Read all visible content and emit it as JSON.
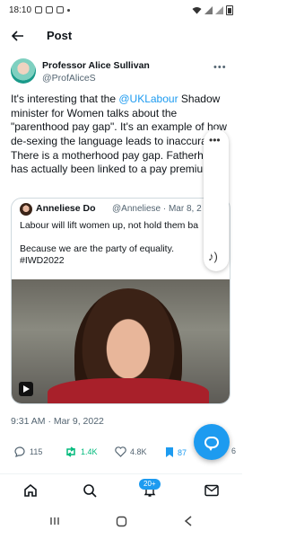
{
  "status_bar": {
    "time": "18:10"
  },
  "header": {
    "title": "Post"
  },
  "author": {
    "name": "Professor Alice Sullivan",
    "handle": "@ProfAliceS"
  },
  "tweet": {
    "lines": [
      {
        "pre": "It's interesting that the ",
        "mention": "@UKLabour",
        "post": " Shadow"
      },
      {
        "pre": "minister for Women talks about the",
        "mention": "",
        "post": ""
      },
      {
        "pre": "\"parenthood pay gap\". It's an example of how",
        "mention": "",
        "post": ""
      },
      {
        "pre": "de-sexing the language leads to inaccuracy.",
        "mention": "",
        "post": ""
      },
      {
        "pre": "There is a motherhood pay gap. Fatherhood",
        "mention": "",
        "post": ""
      },
      {
        "pre": "has actually been linked to a pay premium.",
        "mention": "",
        "post": ""
      }
    ]
  },
  "quoted_tweet": {
    "name": "Anneliese Do",
    "handle_date": "@Anneliese · Mar 8, 2",
    "lines": [
      "Labour will lift women up, not hold them ba",
      "",
      "Because we are the party of equality.",
      "#IWD2022"
    ]
  },
  "timestamp": "9:31 AM · Mar 9, 2022",
  "actions": {
    "replies": "115",
    "reposts": "1.4K",
    "likes": "4.8K",
    "bookmarks": "87",
    "share_count": "6"
  },
  "tabbar": {
    "notifications_badge": "20+"
  },
  "colors": {
    "accent": "#1d9bf0",
    "repost": "#00ba7c",
    "text": "#0f1419",
    "muted": "#536471"
  }
}
